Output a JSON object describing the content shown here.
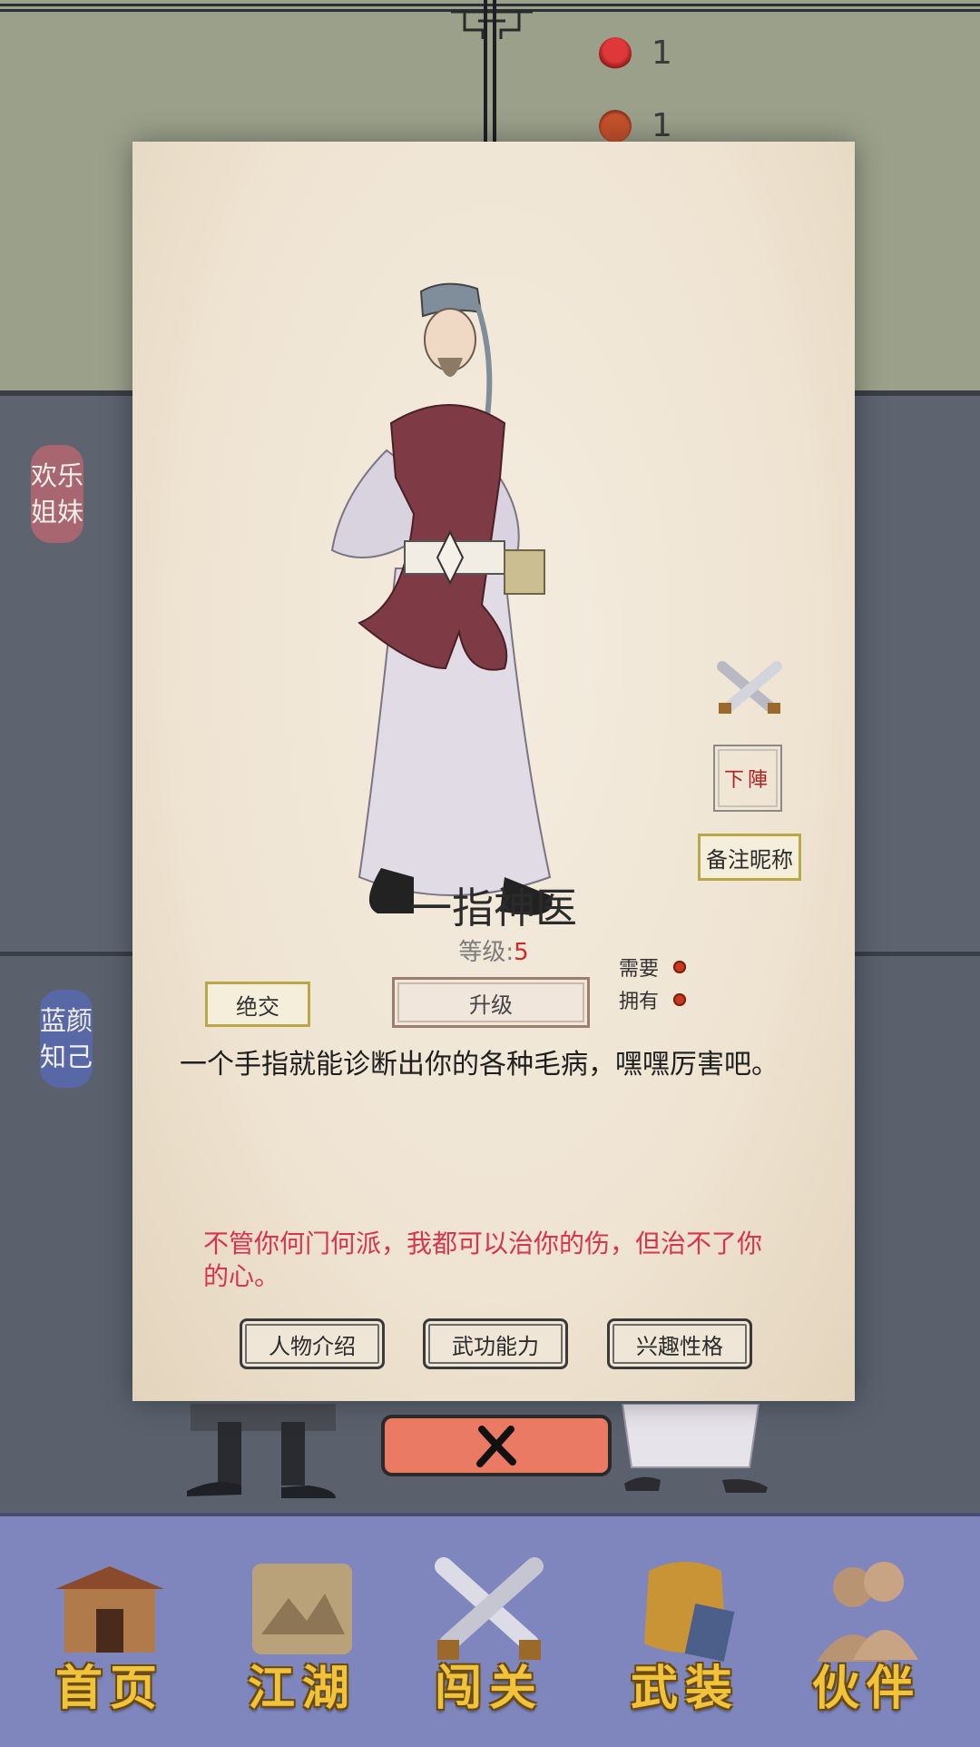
{
  "resources": [
    {
      "icon": "flower-icon",
      "count": "1"
    },
    {
      "icon": "wine-jar-icon",
      "count": "1"
    }
  ],
  "side_tags": {
    "top": "欢乐姐妹",
    "bottom": "蓝颜知己"
  },
  "character": {
    "name": "一指神医",
    "level_label": "等级:",
    "level_value": "5",
    "description": "一个手指就能诊断出你的各种毛病，嘿嘿厉害吧。",
    "quote": "不管你何门何派，我都可以治你的伤，但治不了你的心。"
  },
  "actions": {
    "cut_ties": "绝交",
    "upgrade": "升级",
    "nickname": "备注昵称",
    "deploy": "下陣",
    "need_label": "需要",
    "own_label": "拥有"
  },
  "tabs": [
    "人物介绍",
    "武功能力",
    "兴趣性格"
  ],
  "bottom_nav": [
    "首页",
    "江湖",
    "闯关",
    "武装",
    "伙伴"
  ],
  "colors": {
    "card_bg": "#efe4d2",
    "quote": "#d8344b",
    "level_value": "#d42626",
    "close_button": "#ea7a63",
    "nav_bg": "#7e86bd",
    "nav_label": "#f0c33a"
  }
}
